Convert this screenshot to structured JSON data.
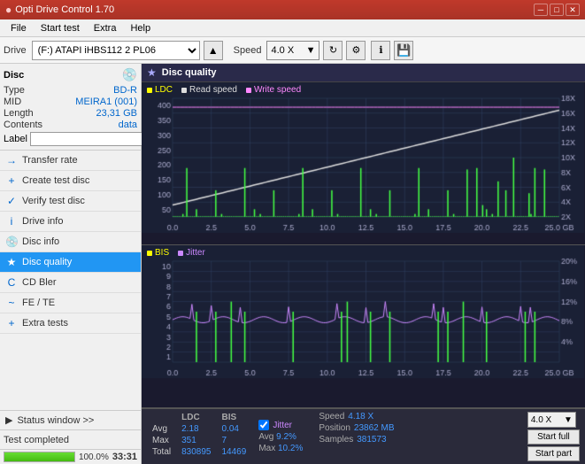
{
  "titlebar": {
    "title": "Opti Drive Control 1.70",
    "minimize": "─",
    "maximize": "□",
    "close": "✕"
  },
  "menubar": {
    "items": [
      "File",
      "Start test",
      "Extra",
      "Help"
    ]
  },
  "toolbar": {
    "drive_label": "Drive",
    "drive_value": "(F:) ATAPI iHBS112  2 PL06",
    "speed_label": "Speed",
    "speed_value": "4.0 X"
  },
  "disc": {
    "label": "Disc",
    "type_label": "Type",
    "type_value": "BD-R",
    "mid_label": "MID",
    "mid_value": "MEIRA1 (001)",
    "length_label": "Length",
    "length_value": "23,31 GB",
    "contents_label": "Contents",
    "contents_value": "data",
    "label_label": "Label",
    "label_value": ""
  },
  "nav": {
    "items": [
      {
        "id": "transfer-rate",
        "label": "Transfer rate",
        "icon": "→"
      },
      {
        "id": "create-test-disc",
        "label": "Create test disc",
        "icon": "+"
      },
      {
        "id": "verify-test-disc",
        "label": "Verify test disc",
        "icon": "✓"
      },
      {
        "id": "drive-info",
        "label": "Drive info",
        "icon": "i"
      },
      {
        "id": "disc-info",
        "label": "Disc info",
        "icon": "📀"
      },
      {
        "id": "disc-quality",
        "label": "Disc quality",
        "icon": "★",
        "active": true
      },
      {
        "id": "cd-bler",
        "label": "CD Bler",
        "icon": "C"
      },
      {
        "id": "fe-te",
        "label": "FE / TE",
        "icon": "~"
      },
      {
        "id": "extra-tests",
        "label": "Extra tests",
        "icon": "+"
      }
    ]
  },
  "status_window": {
    "label": "Status window >>",
    "icon": "▶"
  },
  "chart_header": {
    "title": "Disc quality",
    "icon": "★"
  },
  "chart1": {
    "legend": [
      {
        "label": "LDC",
        "color": "#ffff00"
      },
      {
        "label": "Read speed",
        "color": "#cccccc"
      },
      {
        "label": "Write speed",
        "color": "#ff88ff"
      }
    ],
    "y_max": 400,
    "y_labels": [
      "400",
      "350",
      "300",
      "250",
      "200",
      "150",
      "100",
      "50"
    ],
    "y_right_labels": [
      "18X",
      "16X",
      "14X",
      "12X",
      "10X",
      "8X",
      "6X",
      "4X",
      "2X"
    ],
    "x_labels": [
      "0.0",
      "2.5",
      "5.0",
      "7.5",
      "10.0",
      "12.5",
      "15.0",
      "17.5",
      "20.0",
      "22.5",
      "25.0 GB"
    ]
  },
  "chart2": {
    "legend": [
      {
        "label": "BIS",
        "color": "#ffff00"
      },
      {
        "label": "Jitter",
        "color": "#cc88ff"
      }
    ],
    "y_max": 10,
    "y_labels": [
      "10",
      "9",
      "8",
      "7",
      "6",
      "5",
      "4",
      "3",
      "2",
      "1"
    ],
    "y_right_labels": [
      "20%",
      "16%",
      "12%",
      "8%",
      "4%"
    ],
    "x_labels": [
      "0.0",
      "2.5",
      "5.0",
      "7.5",
      "10.0",
      "12.5",
      "15.0",
      "17.5",
      "20.0",
      "22.5",
      "25.0 GB"
    ]
  },
  "stats": {
    "headers": [
      "",
      "LDC",
      "BIS"
    ],
    "rows": [
      {
        "label": "Avg",
        "ldc": "2.18",
        "bis": "0.04"
      },
      {
        "label": "Max",
        "ldc": "351",
        "bis": "7"
      },
      {
        "label": "Total",
        "ldc": "830895",
        "bis": "14469"
      }
    ],
    "jitter": {
      "label": "Jitter",
      "avg": "9.2%",
      "max": "10.2%"
    },
    "speed_label": "Speed",
    "speed_value": "4.18 X",
    "speed_select": "4.0 X",
    "position_label": "Position",
    "position_value": "23862 MB",
    "samples_label": "Samples",
    "samples_value": "381573",
    "btn_start_full": "Start full",
    "btn_start_part": "Start part"
  },
  "bottom": {
    "status_text": "Test completed",
    "progress_percent": 100,
    "time": "33:31"
  }
}
